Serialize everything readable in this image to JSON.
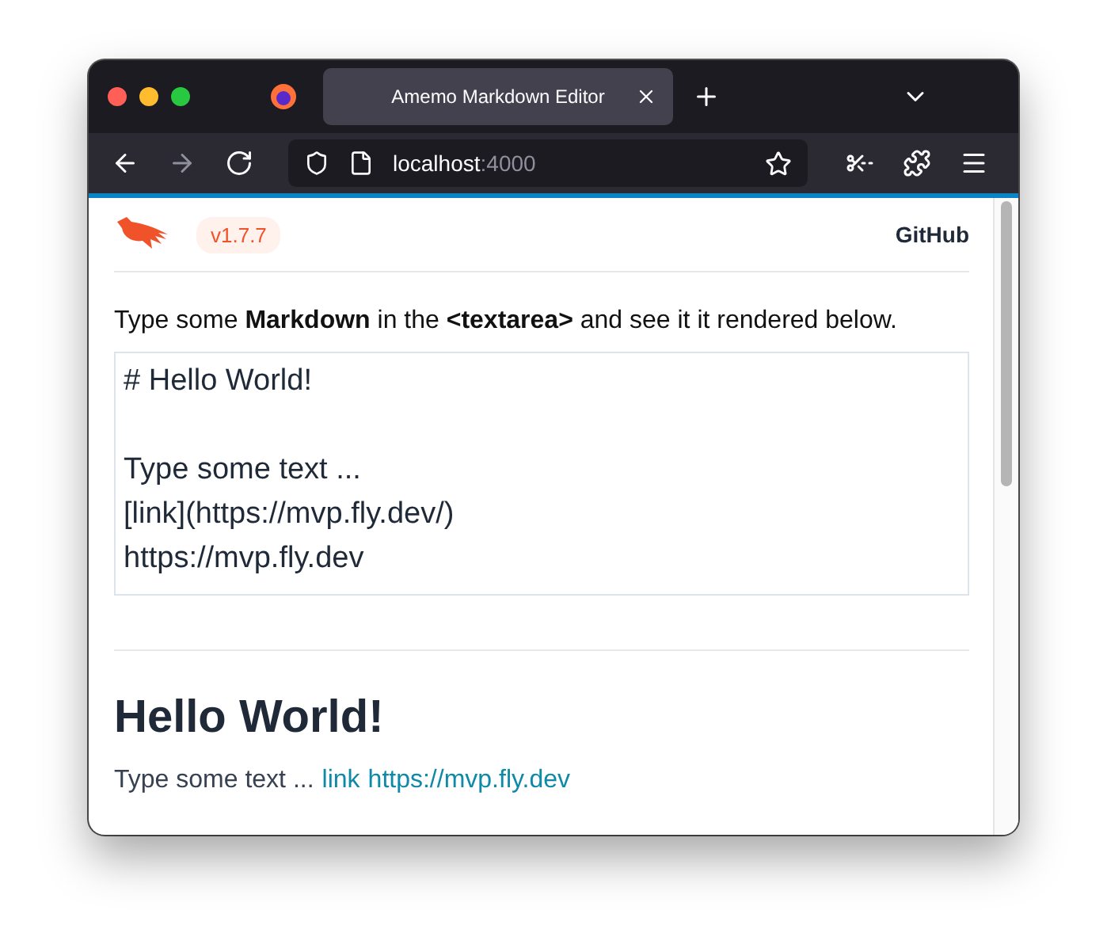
{
  "browser": {
    "tabs": [
      {
        "title": "Amemo Markdown Editor",
        "selected": true
      }
    ],
    "address": {
      "host": "localhost",
      "port": ":4000"
    },
    "nav": [
      {
        "kind": "back",
        "disabled": false
      },
      {
        "kind": "forward",
        "disabled": true
      },
      {
        "kind": "reload",
        "disabled": false
      }
    ]
  },
  "header": {
    "version": "v1.7.7",
    "link": "GitHub"
  },
  "intro": "Type some **Markdown** in the **<textarea>** and see it it rendered below.",
  "editor": {
    "value": "# Hello World!\n\nType some text ...\n[link](https://mvp.fly.dev/)\nhttps://mvp.fly.dev"
  },
  "preview": {
    "heading": "Hello World!",
    "text": "Type some text ...",
    "links": [
      "link",
      "https://mvp.fly.dev"
    ]
  }
}
